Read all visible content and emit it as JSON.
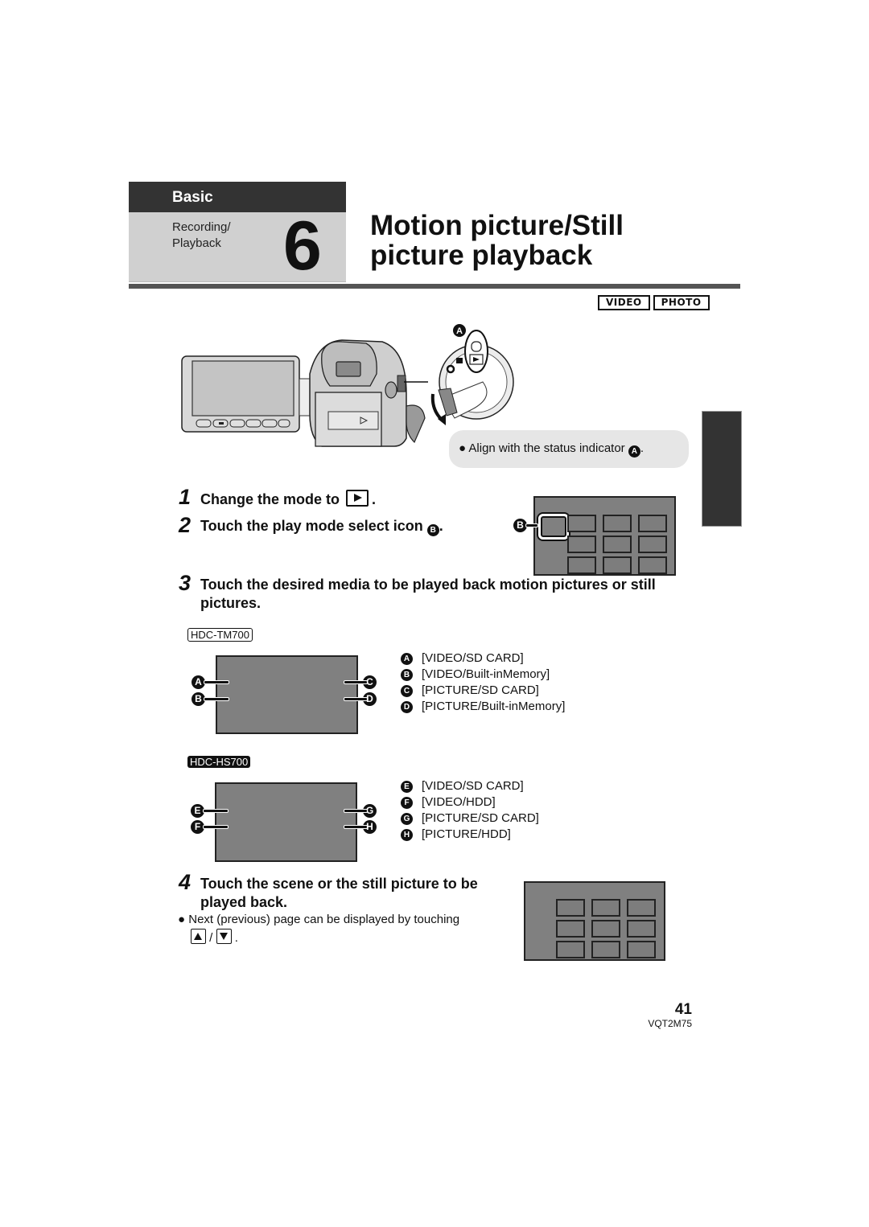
{
  "header": {
    "section": "Basic",
    "subsection_line1": "Recording/",
    "subsection_line2": "Playback",
    "chapter_number": "6",
    "title_line1": "Motion picture/Still",
    "title_line2": "picture playback"
  },
  "mode_badges": [
    "VIDEO",
    "PHOTO"
  ],
  "illustration": {
    "callout_a": "A",
    "tip_text": "Align with the status indicator",
    "tip_ref": "A",
    "tip_end": "."
  },
  "steps": [
    {
      "number": "1",
      "text": "Change the mode to",
      "icon": "play-mode-icon",
      "suffix": "."
    },
    {
      "number": "2",
      "text": "Touch the play mode select icon",
      "ref": "B",
      "suffix": "."
    },
    {
      "number": "3",
      "text_line1": "Touch the desired media to be played back motion pictures or still",
      "text_line2": "pictures."
    },
    {
      "number": "4",
      "text_line1": "Touch the scene or the still picture to be",
      "text_line2": "played back."
    }
  ],
  "step2_screen": {
    "callout": "B",
    "grid_rows": 3,
    "grid_cols": 3
  },
  "models": [
    {
      "name": "HDC-TM700",
      "callouts_left": [
        "A",
        "B"
      ],
      "callouts_right": [
        "C",
        "D"
      ],
      "legend": [
        {
          "key": "A",
          "label": "[VIDEO/SD CARD]"
        },
        {
          "key": "B",
          "label": "[VIDEO/Built-inMemory]"
        },
        {
          "key": "C",
          "label": "[PICTURE/SD CARD]"
        },
        {
          "key": "D",
          "label": "[PICTURE/Built-inMemory]"
        }
      ]
    },
    {
      "name": "HDC-HS700",
      "callouts_left": [
        "E",
        "F"
      ],
      "callouts_right": [
        "G",
        "H"
      ],
      "legend": [
        {
          "key": "E",
          "label": "[VIDEO/SD CARD]"
        },
        {
          "key": "F",
          "label": "[VIDEO/HDD]"
        },
        {
          "key": "G",
          "label": "[PICTURE/SD CARD]"
        },
        {
          "key": "H",
          "label": "[PICTURE/HDD]"
        }
      ]
    }
  ],
  "step4_note": {
    "text": "Next (previous) page can be displayed by touching",
    "separator": "/",
    "end": "."
  },
  "footer": {
    "page_number": "41",
    "doc_code": "VQT2M75"
  }
}
